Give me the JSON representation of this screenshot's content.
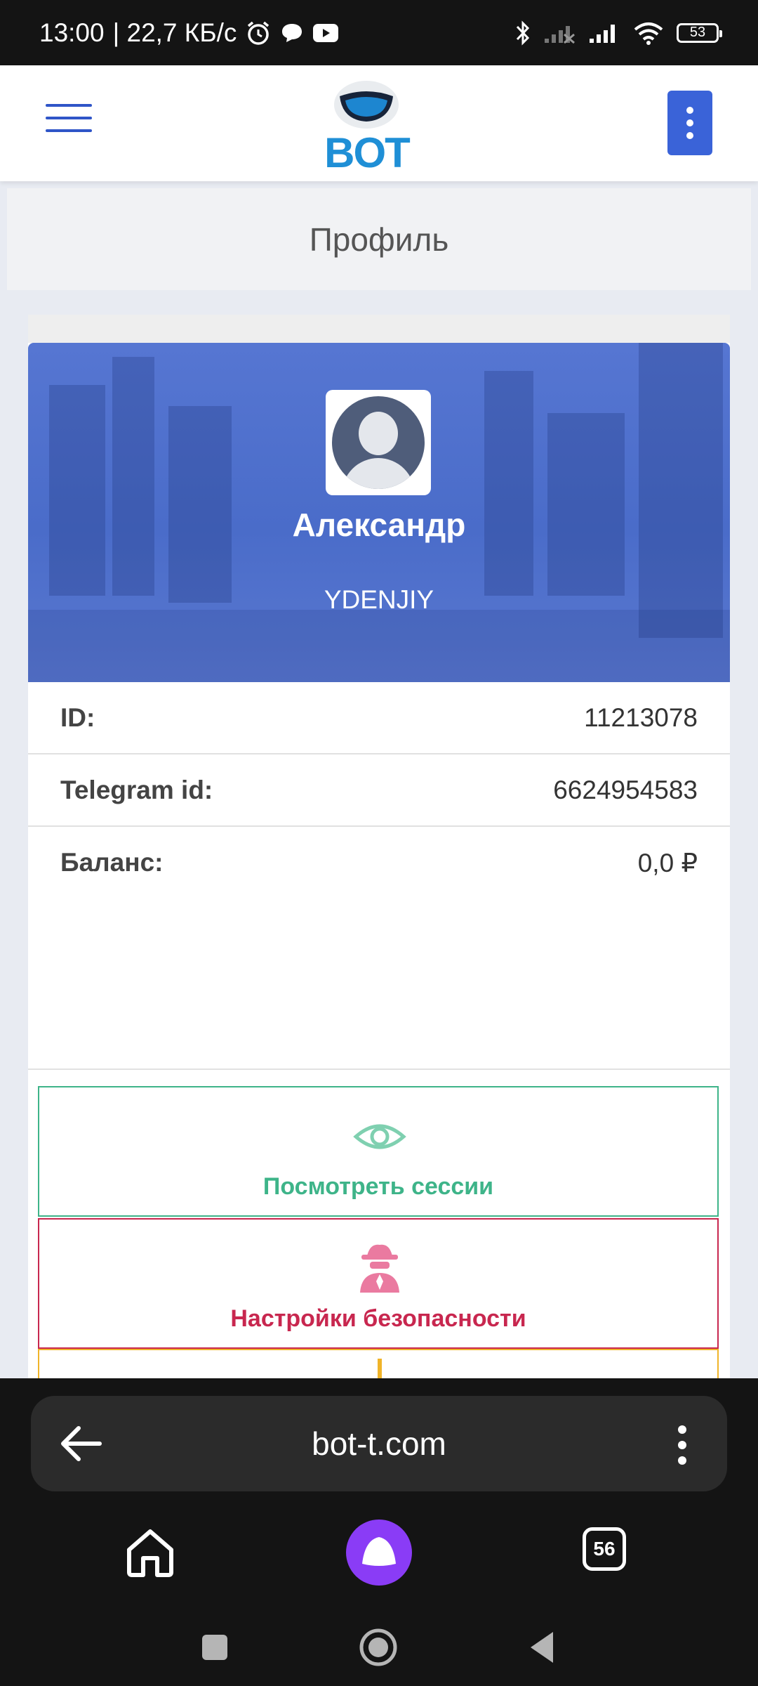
{
  "status_bar": {
    "time": "13:00",
    "speed": "| 22,7 КБ/с",
    "battery": "53"
  },
  "header": {
    "logo_text": "BOT",
    "accent_color": "#3a63d8"
  },
  "page": {
    "title": "Профиль"
  },
  "profile": {
    "name": "Александр",
    "username": "YDENJIY",
    "rows": [
      {
        "label": "ID:",
        "value": "11213078"
      },
      {
        "label": "Telegram id:",
        "value": "6624954583"
      },
      {
        "label": "Баланс:",
        "value": "0,0 ₽"
      }
    ]
  },
  "actions": {
    "sessions_label": "Посмотреть сессии",
    "security_label": "Настройки безопасности"
  },
  "browser": {
    "url": "bot-t.com",
    "tab_count": "56"
  }
}
